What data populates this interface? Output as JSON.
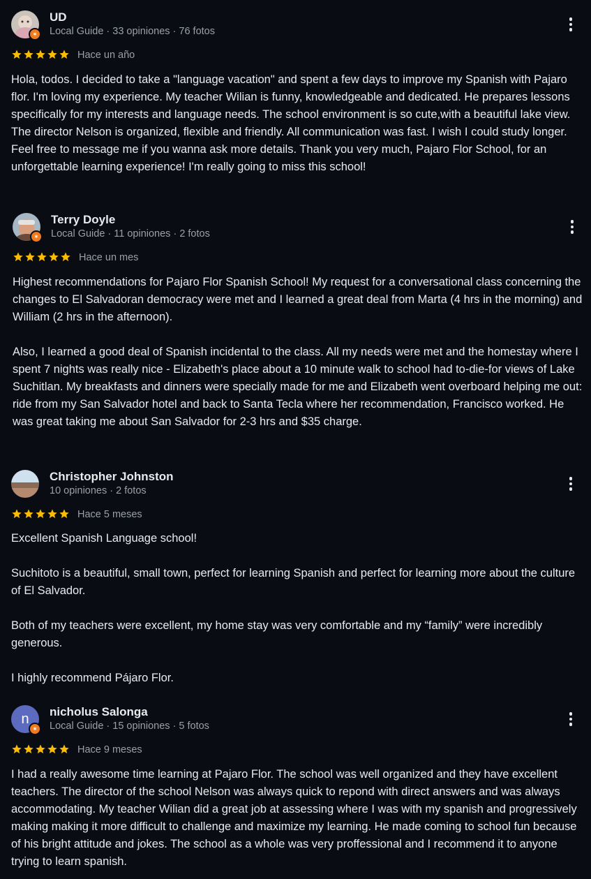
{
  "colors": {
    "background": "#0a0c14",
    "star": "#fbbc04",
    "badge": "#f07a1e",
    "text": "#e8eaed",
    "muted": "#9aa0a6"
  },
  "reviews": [
    {
      "name": "UD",
      "meta": "Local Guide · 33 opiniones · 76 fotos",
      "rating": 5,
      "time": "Hace un año",
      "text": "Hola, todos. I decided to take a \"language vacation\" and spent a few days to improve my Spanish with Pajaro flor. I'm loving my experience. My teacher Wilian is funny, knowledgeable and dedicated. He prepares lessons specifically for my interests and language needs. The school environment is so cute,with a beautiful lake view. The director Nelson is organized, flexible and friendly. All communication was fast. I wish I could study longer. Feel free to message me if you wanna ask more details. Thank you very much, Pajaro Flor School, for an unforgettable learning experience! I'm really going to miss this school!"
    },
    {
      "name": "Terry Doyle",
      "meta": "Local Guide · 11 opiniones · 2 fotos",
      "rating": 5,
      "time": "Hace un mes",
      "text": "Highest recommendations for Pajaro Flor Spanish School! My request for a conversational class concerning the changes to El Salvadoran democracy were met and I learned a great deal from Marta (4 hrs in the morning) and William (2 hrs in the afternoon).\n\nAlso, I learned a good deal of Spanish incidental to the class. All my needs were met and the homestay where I spent 7 nights was really nice - Elizabeth's place about a 10 minute walk to school had to-die-for views of Lake Suchitlan. My breakfasts and dinners were specially made for me and Elizabeth went overboard helping me out: ride from my San Salvador hotel and back to Santa Tecla where her recommendation, Francisco worked. He was great taking me about San Salvador for 2-3 hrs and $35 charge."
    },
    {
      "name": "Christopher Johnston",
      "meta": "10 opiniones · 2 fotos",
      "rating": 5,
      "time": "Hace 5 meses",
      "text": "Excellent Spanish Language school!\n\nSuchitoto is a beautiful, small town, perfect for learning Spanish and perfect for learning more about the culture of El Salvador.\n\nBoth of my teachers were excellent, my home stay was very comfortable and my “family” were incredibly generous.\n\nI highly recommend Pájaro Flor."
    },
    {
      "name": "nicholus Salonga",
      "avatar_letter": "n",
      "meta": "Local Guide · 15 opiniones · 5 fotos",
      "rating": 5,
      "time": "Hace 9 meses",
      "text": "I had a really awesome time learning at Pajaro Flor. The school was well organized and they have excellent teachers. The director of the school Nelson was always quick to repond with direct answers and was always accommodating. My teacher Wilian did a great job at assessing where I was with my spanish and progressively making making it more difficult to challenge and maximize my learning. He made coming to school fun because of his bright attitude and jokes. The school as a whole was very proffessional and I recommend it to anyone trying to learn spanish."
    }
  ]
}
